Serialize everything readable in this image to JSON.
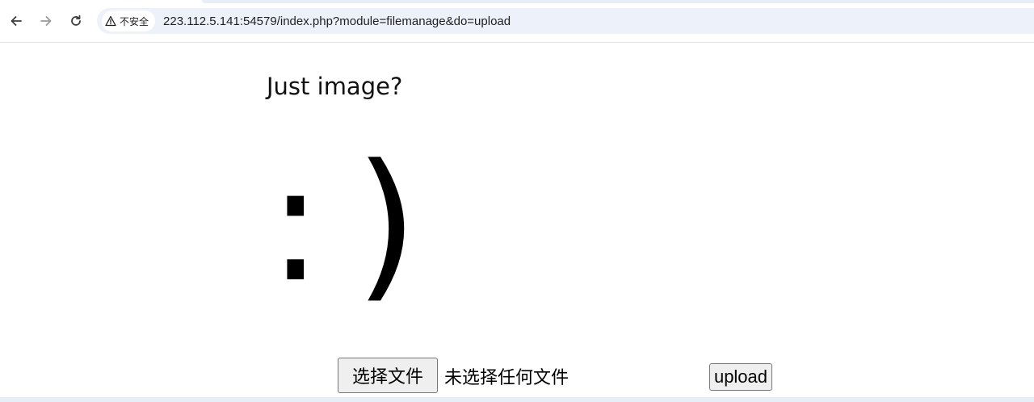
{
  "browser": {
    "back_icon": "arrow-left-icon",
    "forward_icon": "arrow-right-icon",
    "reload_icon": "reload-icon",
    "security_icon": "warning-triangle-icon",
    "security_label": "不安全",
    "url": "223.112.5.141:54579/index.php?module=filemanage&do=upload"
  },
  "page": {
    "title": "Just image?",
    "smiley": ":)"
  },
  "form": {
    "choose_file_label": "选择文件",
    "no_file_text": "未选择任何文件",
    "upload_label": "upload"
  }
}
